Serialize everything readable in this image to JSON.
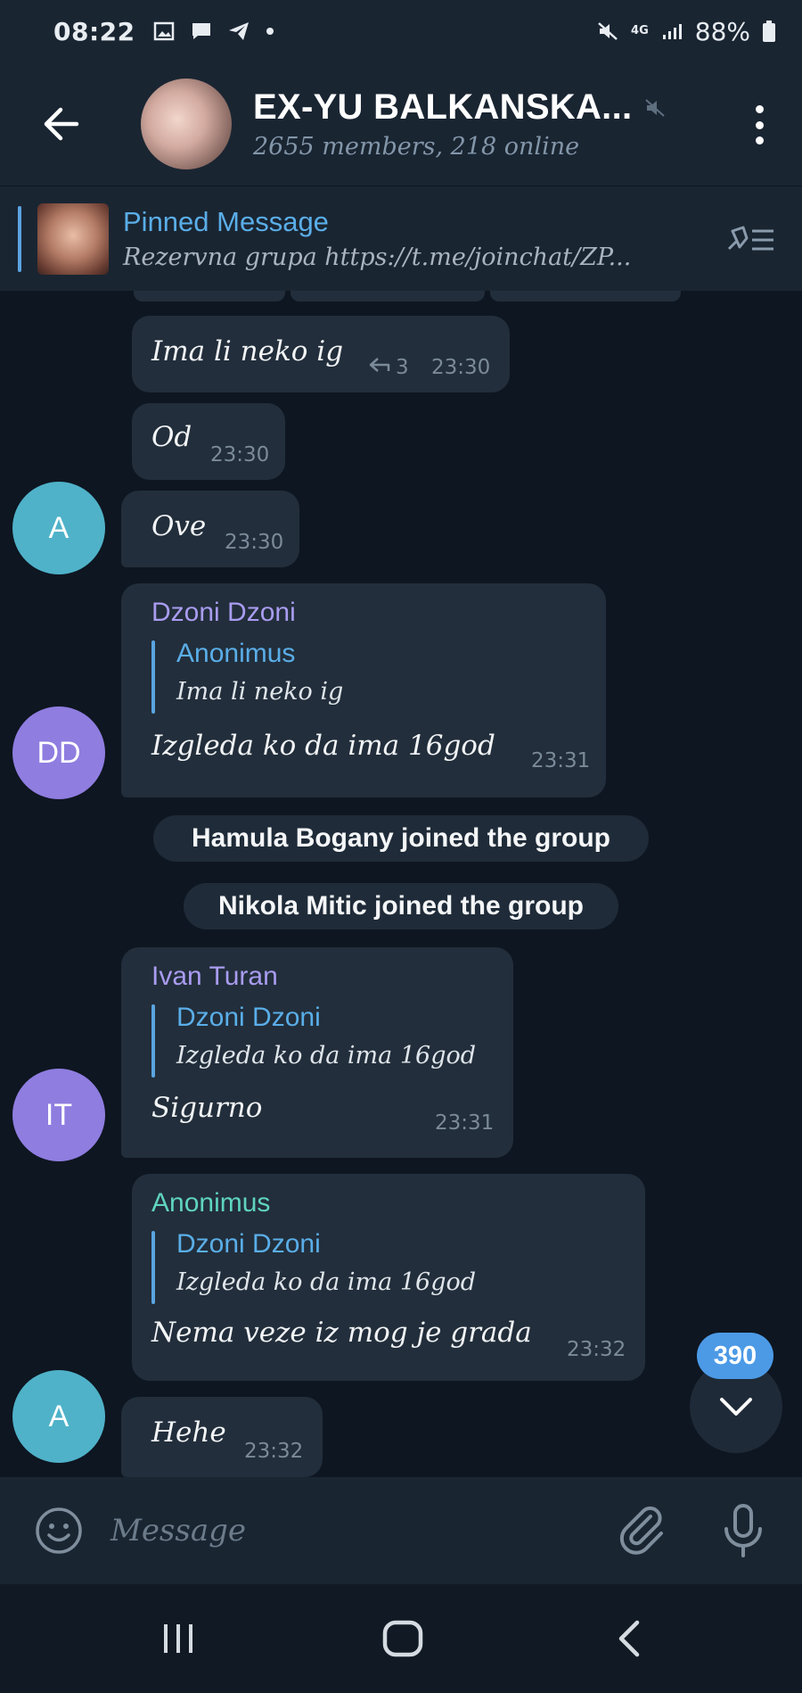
{
  "status_bar": {
    "time": "08:22",
    "battery": "88%",
    "network": "4G"
  },
  "header": {
    "title": "EX-YU BALKANSKA...",
    "subtitle": "2655 members, 218 online"
  },
  "pinned": {
    "title": "Pinned Message",
    "text": "Rezervna grupa https://t.me/joinchat/ZP..."
  },
  "messages": [
    {
      "text": "Ima li neko ig",
      "replies": "3",
      "time": "23:30"
    },
    {
      "text": "Od",
      "time": "23:30"
    },
    {
      "text": "Ove",
      "time": "23:30",
      "avatar": "A"
    },
    {
      "sender": "Dzoni Dzoni",
      "quote_name": "Anonimus",
      "quote_text": "Ima li neko ig",
      "text": "Izgleda ko da ima 16god",
      "time": "23:31",
      "avatar": "DD"
    },
    {
      "service": "Hamula Bogany joined the group"
    },
    {
      "service": "Nikola Mitic joined the group"
    },
    {
      "sender": "Ivan Turan",
      "quote_name": "Dzoni Dzoni",
      "quote_text": "Izgleda ko da ima 16god",
      "text": "Sigurno",
      "time": "23:31",
      "avatar": "IT"
    },
    {
      "sender": "Anonimus",
      "quote_name": "Dzoni Dzoni",
      "quote_text": "Izgleda ko da ima 16god",
      "text": "Nema veze iz mog je grada",
      "time": "23:32"
    },
    {
      "text": "Hehe",
      "time": "23:32",
      "avatar": "A"
    }
  ],
  "scroll_badge": "390",
  "input": {
    "placeholder": "Message"
  },
  "colors": {
    "background": "#0e1621",
    "bubble": "#222e3b",
    "header": "#1a2532",
    "accent": "#5aaee8",
    "avatar_a": "#4fb2c9",
    "avatar_purple": "#8f7de0",
    "sender_purple": "#a99cf0",
    "sender_teal": "#5fd4bf"
  },
  "icons": [
    "back-arrow-icon",
    "muted-icon",
    "more-vert-icon",
    "pin-list-icon",
    "chevron-down-icon",
    "emoji-icon",
    "attach-icon",
    "mic-icon",
    "nav-recents-icon",
    "nav-home-icon",
    "nav-back-icon"
  ]
}
